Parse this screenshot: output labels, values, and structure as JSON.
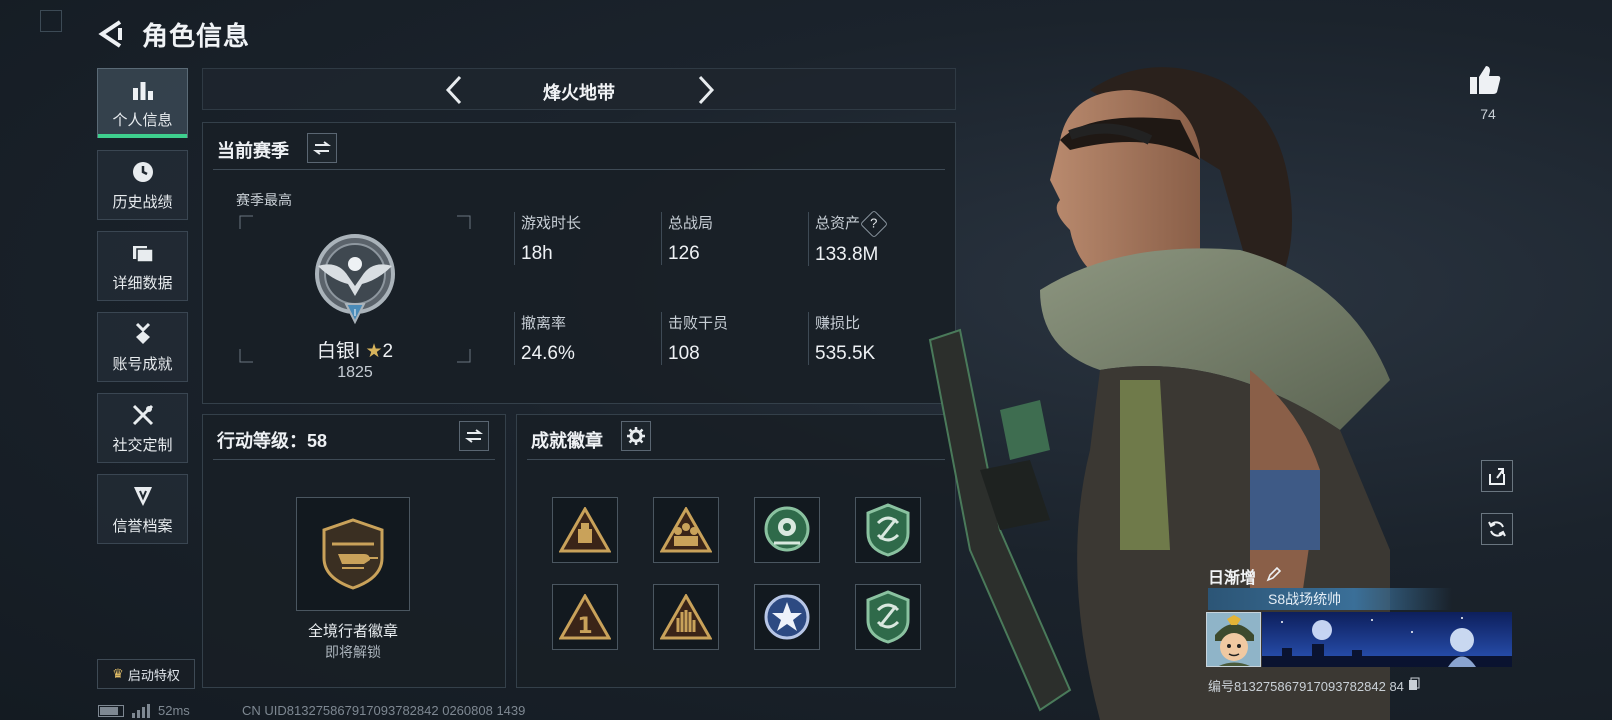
{
  "header": {
    "title": "角色信息"
  },
  "nav": [
    {
      "label": "个人信息",
      "icon": "bar-chart-icon",
      "active": true
    },
    {
      "label": "历史战绩",
      "icon": "clock-icon",
      "active": false
    },
    {
      "label": "详细数据",
      "icon": "folder-icon",
      "active": false
    },
    {
      "label": "账号成就",
      "icon": "medal-icon",
      "active": false
    },
    {
      "label": "社交定制",
      "icon": "tools-icon",
      "active": false
    },
    {
      "label": "信誉档案",
      "icon": "shield-badge-icon",
      "active": false
    }
  ],
  "mode": {
    "title": "烽火地带"
  },
  "season": {
    "title": "当前赛季",
    "best_label": "赛季最高",
    "rank_name": "白银I",
    "rank_stars": "2",
    "rank_score": "1825",
    "stats": [
      {
        "label": "游戏时长",
        "value": "18h"
      },
      {
        "label": "总战局",
        "value": "126"
      },
      {
        "label": "总资产",
        "value": "133.8M",
        "help": "?"
      },
      {
        "label": "撤离率",
        "value": "24.6%"
      },
      {
        "label": "击败干员",
        "value": "108"
      },
      {
        "label": "赚损比",
        "value": "535.5K"
      }
    ]
  },
  "action_level": {
    "title": "行动等级：58",
    "badge_name": "全境行者徽章",
    "badge_status": "即将解锁"
  },
  "achievements": {
    "title": "成就徽章",
    "badges": [
      "triangle-cargo-icon",
      "triangle-squad-icon",
      "green-rose-icon",
      "green-shield-icon",
      "triangle-one-icon",
      "triangle-hand-icon",
      "blue-star-icon",
      "green-shield-icon"
    ]
  },
  "privilege_button": "启动特权",
  "status": {
    "ping": "52ms",
    "uid": "CN UID813275867917093782842 0260808 1439"
  },
  "like": {
    "count": "74"
  },
  "profile": {
    "name": "日渐增",
    "title": "S8战场统帅",
    "id_label": "编号813275867917093782842 84"
  },
  "colors": {
    "accent": "#3ecf8e",
    "gold": "#c9a25a",
    "green_badge": "#3f8a5c"
  }
}
